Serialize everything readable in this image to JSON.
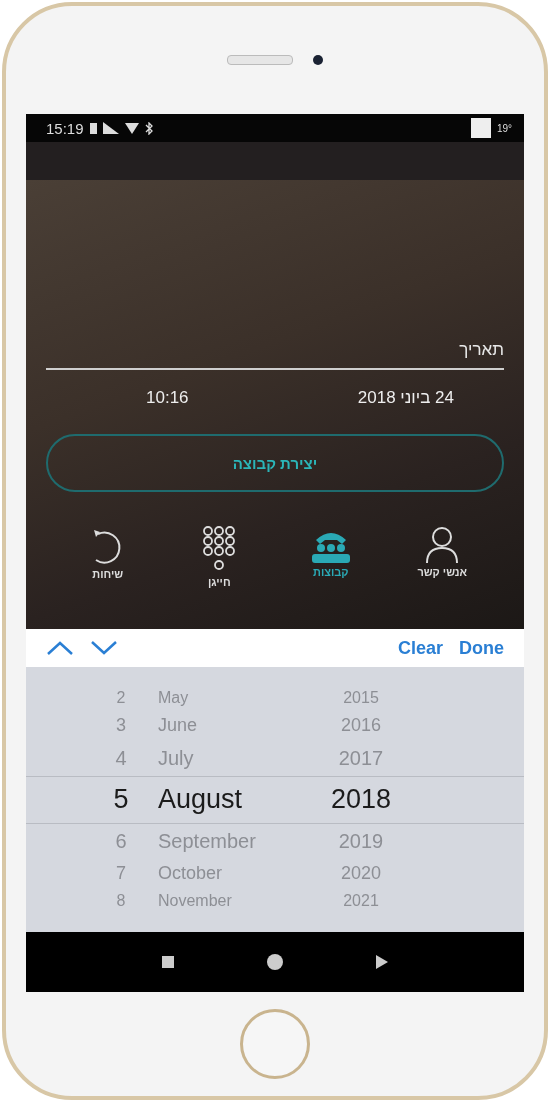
{
  "status_bar": {
    "time": "15:19",
    "temperature": "19°"
  },
  "date_field": {
    "label": "תאריך",
    "date": "24 ביוני 2018",
    "time": "10:16"
  },
  "create_button": {
    "label": "יצירת קבוצה"
  },
  "tabs": [
    {
      "label": "אנשי קשר",
      "kind": "person",
      "selected": false
    },
    {
      "label": "קבוצות",
      "kind": "group",
      "selected": true
    },
    {
      "label": "חייגן",
      "kind": "dialpad",
      "selected": false
    },
    {
      "label": "שיחות",
      "kind": "history",
      "selected": false
    }
  ],
  "toolbar": {
    "clear": "Clear",
    "done": "Done"
  },
  "picker_rows": [
    {
      "day": "2",
      "month": "May",
      "year": "2015",
      "selected": false
    },
    {
      "day": "3",
      "month": "June",
      "year": "2016",
      "selected": false
    },
    {
      "day": "4",
      "month": "July",
      "year": "2017",
      "selected": false
    },
    {
      "day": "5",
      "month": "August",
      "year": "2018",
      "selected": true
    },
    {
      "day": "6",
      "month": "September",
      "year": "2019",
      "selected": false
    },
    {
      "day": "7",
      "month": "October",
      "year": "2020",
      "selected": false
    },
    {
      "day": "8",
      "month": "November",
      "year": "2021",
      "selected": false
    }
  ]
}
